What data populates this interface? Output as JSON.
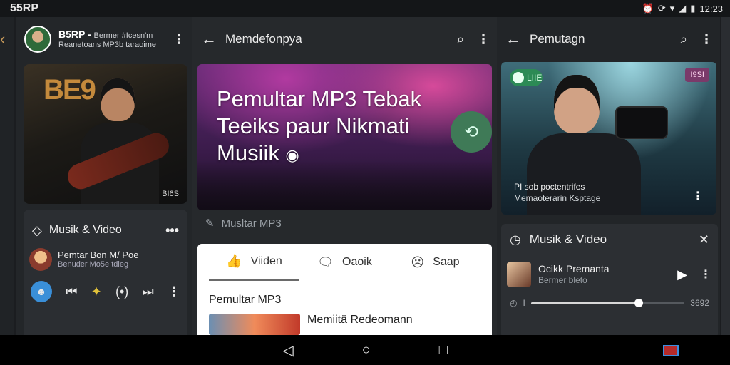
{
  "status_bar": {
    "title": "55RP",
    "time": "12:23"
  },
  "panel1": {
    "account_name": "B5RP -",
    "account_name_extra": "Bermer #Icesn'm",
    "account_sub": "Reanetoans MP3b taraoime",
    "image_badge": "BI6S",
    "image_sign": "BE9",
    "section_title": "Musik & Video",
    "track_title": "Pemtar Bon M/ Poe",
    "track_sub": "Benuder Mo5e tdieg"
  },
  "panel2": {
    "title": "Memdefonpya",
    "hero_text": "Pemultar MP3 Tebak Teeiks paur Nikmati Musiik",
    "sub_header": "Musltar MP3",
    "tabs": [
      {
        "label": "Viiden",
        "icon": "thumb-up-icon"
      },
      {
        "label": "Oaoik",
        "icon": "comment-icon"
      },
      {
        "label": "Saap",
        "icon": "emoji-icon"
      }
    ],
    "section_title": "Pemultar MP3",
    "item_title": "Memiitä Redeomann"
  },
  "panel3": {
    "title": "Pemutagn",
    "pill_label": "LIIE",
    "tag_label": "I9SI",
    "caption1": "PI sob poctentrifes",
    "caption2": "Memaoterarin Ksptage",
    "card_title": "Musik & Video",
    "track_title": "Ocikk Premanta",
    "track_sub": "Bermer bleto",
    "time_left": "I",
    "time_right": "3692",
    "progress": 0.7
  },
  "colors": {
    "accent_green": "#3f7a57",
    "accent_blue": "#3a8fd8",
    "record_red": "#b52a2a"
  }
}
